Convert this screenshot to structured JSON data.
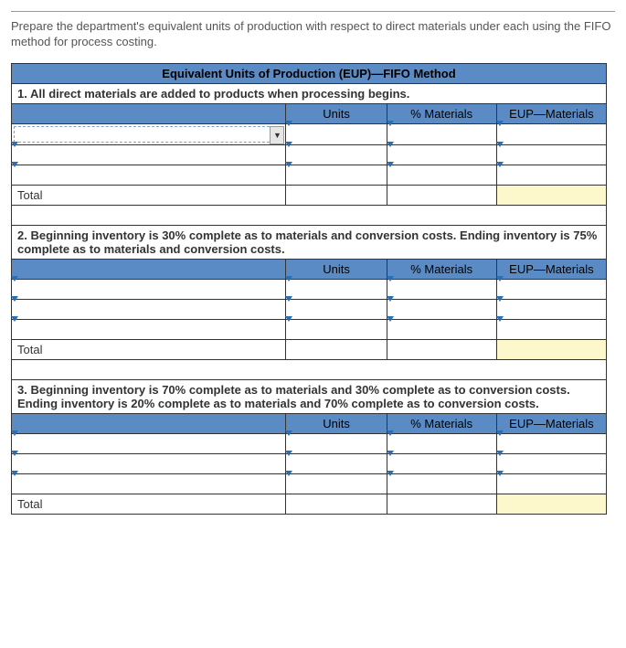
{
  "instructions": "Prepare the department's equivalent units of production with respect to direct materials under each using the FIFO method for process costing.",
  "title": "Equivalent Units of Production (EUP)—FIFO Method",
  "columns": {
    "units": "Units",
    "pct_materials": "% Materials",
    "eup_materials": "EUP—Materials"
  },
  "total_label": "Total",
  "sections": [
    {
      "header": "1. All direct materials are added to products when processing begins.",
      "rows": [
        {
          "desc": "",
          "units": "",
          "pct": "",
          "eup": ""
        },
        {
          "desc": "",
          "units": "",
          "pct": "",
          "eup": ""
        },
        {
          "desc": "",
          "units": "",
          "pct": "",
          "eup": ""
        }
      ],
      "total": {
        "units": "",
        "eup": ""
      }
    },
    {
      "header": "2. Beginning inventory is 30% complete as to materials and conversion costs. Ending inventory is 75% complete as to materials and conversion costs.",
      "rows": [
        {
          "desc": "",
          "units": "",
          "pct": "",
          "eup": ""
        },
        {
          "desc": "",
          "units": "",
          "pct": "",
          "eup": ""
        },
        {
          "desc": "",
          "units": "",
          "pct": "",
          "eup": ""
        }
      ],
      "total": {
        "units": "",
        "eup": ""
      }
    },
    {
      "header": "3. Beginning inventory is 70% complete as to materials and 30% complete as to conversion costs. Ending inventory is 20% complete as to materials and 70% complete as to conversion costs.",
      "rows": [
        {
          "desc": "",
          "units": "",
          "pct": "",
          "eup": ""
        },
        {
          "desc": "",
          "units": "",
          "pct": "",
          "eup": ""
        },
        {
          "desc": "",
          "units": "",
          "pct": "",
          "eup": ""
        }
      ],
      "total": {
        "units": "",
        "eup": ""
      }
    }
  ]
}
